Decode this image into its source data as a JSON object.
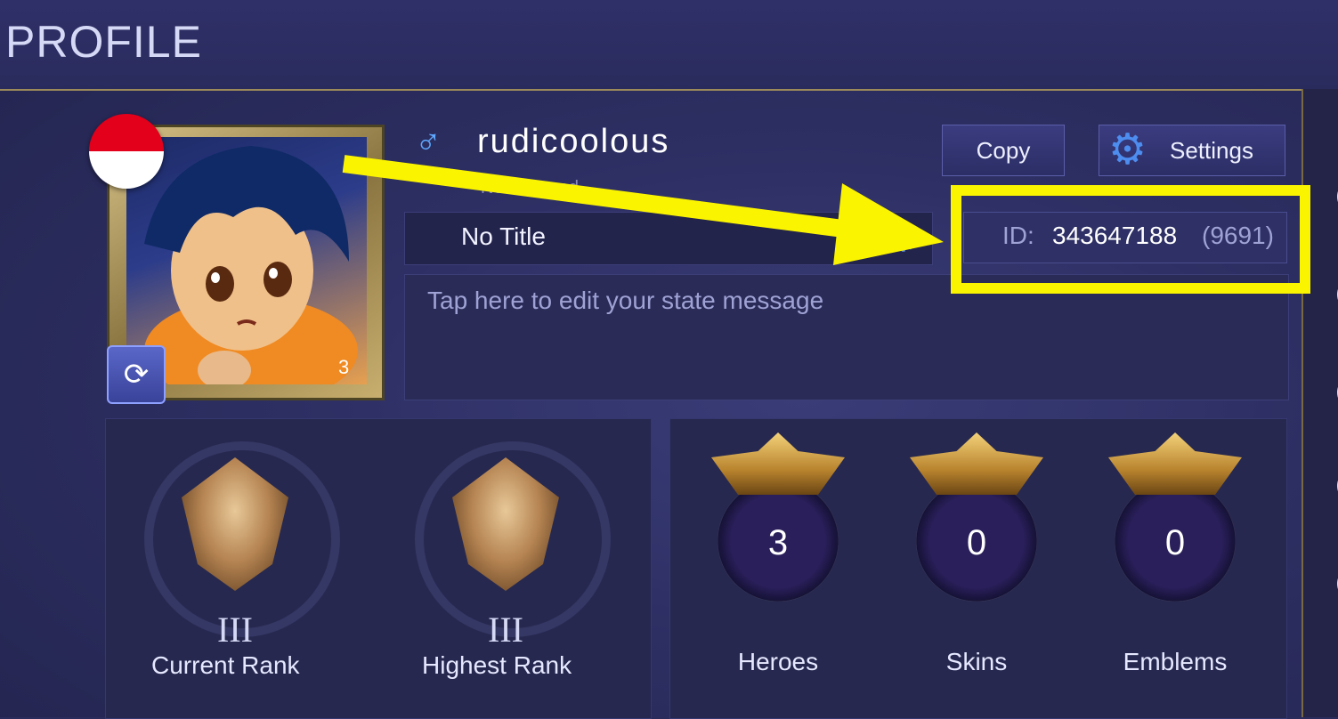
{
  "header": {
    "title": "PROFILE"
  },
  "profile": {
    "username": "rudicoolous",
    "gender_icon": "male-icon",
    "hidden_subtext": "Not Favored",
    "avatar_level": "3",
    "flag_colors": [
      "#e2001a",
      "#ffffff"
    ],
    "title": "No Title",
    "state_placeholder": "Tap here to edit your state message",
    "id_label": "ID:",
    "id_value": "343647188",
    "server_zone": "(9691)"
  },
  "buttons": {
    "copy": "Copy",
    "settings": "Settings"
  },
  "ranks": [
    {
      "tier": "III",
      "label": "Current Rank"
    },
    {
      "tier": "III",
      "label": "Highest Rank"
    }
  ],
  "stats": [
    {
      "value": "3",
      "label": "Heroes"
    },
    {
      "value": "0",
      "label": "Skins"
    },
    {
      "value": "0",
      "label": "Emblems"
    }
  ],
  "annotation": {
    "highlight_color": "#fbf400"
  }
}
